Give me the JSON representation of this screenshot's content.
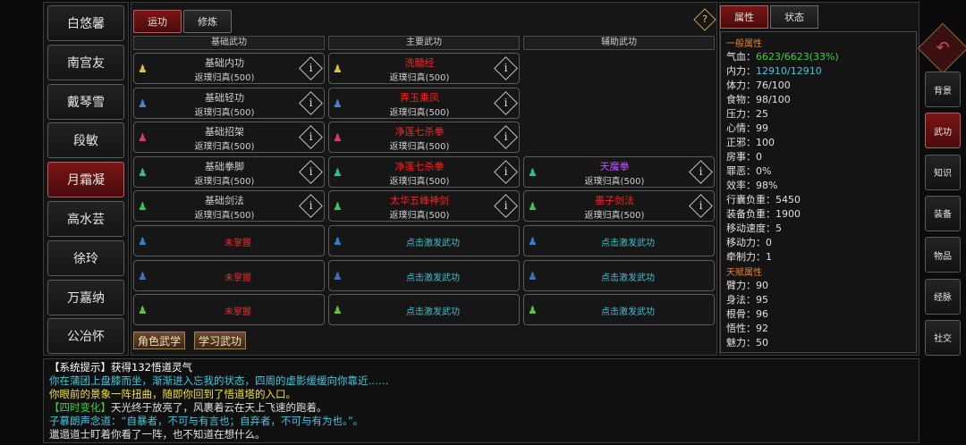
{
  "characters": [
    {
      "name": "白悠馨",
      "active": false
    },
    {
      "name": "南宫友",
      "active": false
    },
    {
      "name": "戴琴雪",
      "active": false
    },
    {
      "name": "段敏",
      "active": false
    },
    {
      "name": "月霜凝",
      "active": true
    },
    {
      "name": "高水芸",
      "active": false
    },
    {
      "name": "徐玲",
      "active": false
    },
    {
      "name": "万嘉纳",
      "active": false
    },
    {
      "name": "公冶怀",
      "active": false
    }
  ],
  "tabs": {
    "active": "运功",
    "other": "修炼"
  },
  "help_label": "?",
  "columns": [
    "基础武功",
    "主要武功",
    "辅助武功"
  ],
  "info_label": "i",
  "basic": [
    {
      "name": "基础内功",
      "level": "返璞归真(500)",
      "color": "#cfcfcf",
      "icon_color": "#e0c040"
    },
    {
      "name": "基础轻功",
      "level": "返璞归真(500)",
      "color": "#cfcfcf",
      "icon_color": "#5080d0"
    },
    {
      "name": "基础招架",
      "level": "返璞归真(500)",
      "color": "#cfcfcf",
      "icon_color": "#d04060"
    },
    {
      "name": "基础拳脚",
      "level": "返璞归真(500)",
      "color": "#cfcfcf",
      "icon_color": "#30c080"
    },
    {
      "name": "基础剑法",
      "level": "返璞归真(500)",
      "color": "#cfcfcf",
      "icon_color": "#40c060"
    },
    {
      "name": "未掌握",
      "color": "#e03030",
      "icon_color": "#3080d0"
    },
    {
      "name": "未掌握",
      "color": "#e03030",
      "icon_color": "#4070c0"
    },
    {
      "name": "未掌握",
      "color": "#e03030",
      "icon_color": "#60c040"
    }
  ],
  "main": [
    {
      "name": "洗髓经",
      "level": "返璞归真(500)",
      "color": "#ff2020",
      "icon_color": "#e0c040"
    },
    {
      "name": "弄玉乘凤",
      "level": "返璞归真(500)",
      "color": "#ff2020",
      "icon_color": "#5080d0"
    },
    {
      "name": "净莲七杀拳",
      "level": "返璞归真(500)",
      "color": "#ff2020",
      "icon_color": "#d04060"
    },
    {
      "name": "净莲七杀拳",
      "level": "返璞归真(500)",
      "color": "#ff2020",
      "icon_color": "#30c080"
    },
    {
      "name": "太华五峰神剑",
      "level": "返璞归真(500)",
      "color": "#ff2020",
      "icon_color": "#40c060"
    },
    {
      "name": "点击激发武功",
      "color": "#40c0d0",
      "icon_color": "#3080d0"
    },
    {
      "name": "点击激发武功",
      "color": "#40c0d0",
      "icon_color": "#4070c0"
    },
    {
      "name": "点击激发武功",
      "color": "#40c0d0",
      "icon_color": "#60c040"
    }
  ],
  "aux": [
    {
      "row": 3,
      "name": "天魔拳",
      "level": "返璞归真(500)",
      "color": "#c050ff",
      "icon_color": "#30c080"
    },
    {
      "row": 4,
      "name": "墨子剑法",
      "level": "返璞归真(500)",
      "color": "#ff2020",
      "icon_color": "#40c060"
    },
    {
      "row": 5,
      "name": "点击激发武功",
      "color": "#40c0d0",
      "icon_color": "#3080d0"
    },
    {
      "row": 6,
      "name": "点击激发武功",
      "color": "#40c0d0",
      "icon_color": "#4070c0"
    },
    {
      "row": 7,
      "name": "点击激发武功",
      "color": "#40c0d0",
      "icon_color": "#60c040"
    }
  ],
  "buttons": {
    "char_martial": "角色武学",
    "learn_martial": "学习武功"
  },
  "attr_tabs": {
    "active": "属性",
    "other": "状态"
  },
  "general_title": "一般属性",
  "general": [
    {
      "label": "气血：",
      "value": "6623/6623(33%)",
      "color": "#40d040"
    },
    {
      "label": "内力：",
      "value": "12910/12910",
      "color": "#40c8e0"
    },
    {
      "label": "体力：",
      "value": "76/100"
    },
    {
      "label": "食物：",
      "value": "98/100"
    },
    {
      "label": "压力：",
      "value": "25"
    },
    {
      "label": "心情：",
      "value": "99"
    },
    {
      "label": "正邪：",
      "value": "100"
    },
    {
      "label": "房事：",
      "value": "0"
    },
    {
      "label": "罪恶：",
      "value": "0%"
    },
    {
      "label": "效率：",
      "value": "98%"
    },
    {
      "label": "行囊负重：",
      "value": "5450"
    },
    {
      "label": "装备负重：",
      "value": "1900"
    },
    {
      "label": "移动速度：",
      "value": "5"
    },
    {
      "label": "移动力：",
      "value": "0"
    },
    {
      "label": "牵制力：",
      "value": "1"
    }
  ],
  "talent_title": "天赋属性",
  "talent": [
    {
      "label": "臂力：",
      "value": "90"
    },
    {
      "label": "身法：",
      "value": "95"
    },
    {
      "label": "根骨：",
      "value": "96"
    },
    {
      "label": "悟性：",
      "value": "92"
    },
    {
      "label": "魅力：",
      "value": "50"
    }
  ],
  "side_menu": [
    {
      "label": "背景",
      "active": false
    },
    {
      "label": "武功",
      "active": true
    },
    {
      "label": "知识",
      "active": false
    },
    {
      "label": "装备",
      "active": false
    },
    {
      "label": "物品",
      "active": false
    },
    {
      "label": "经脉",
      "active": false
    },
    {
      "label": "社交",
      "active": false
    }
  ],
  "log": [
    {
      "prefix": "【系统提示】",
      "text": "获得132悟道灵气",
      "prefix_color": "#ffffff",
      "color": "#ffffff"
    },
    {
      "prefix": "",
      "text": "你在蒲团上盘膝而坐，渐渐进入忘我的状态，四周的虚影缓缓向你靠近……",
      "prefix_color": "#40c8e0",
      "color": "#40c8e0"
    },
    {
      "prefix": "",
      "text": "你眼前的景象一阵扭曲，随即你回到了悟道塔的入口。",
      "prefix_color": "#f0e040",
      "color": "#f0e040"
    },
    {
      "prefix": "【四时变化】",
      "text": "天光终于放亮了，风裹着云在天上飞速的跑着。",
      "prefix_color": "#40d040",
      "color": "#e0e0e0"
    },
    {
      "prefix": "",
      "text": "子慕朗声念道：“自暴者，不可与有言也；自弃者，不可与有为也。”。",
      "prefix_color": "#40c8e0",
      "color": "#40c8e0"
    },
    {
      "prefix": "",
      "text": "邋遢道士盯着你看了一阵，也不知道在想什么。",
      "prefix_color": "#e0e0e0",
      "color": "#e0e0e0"
    }
  ]
}
